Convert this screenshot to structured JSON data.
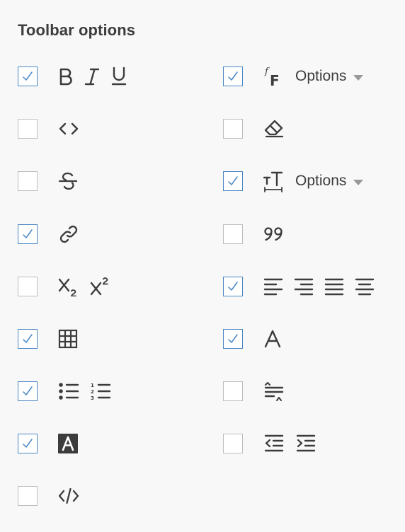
{
  "panel": {
    "title": "Toolbar options",
    "accent_color": "#4a86c5",
    "unchecked_border_color": "#bdbdbd"
  },
  "left_column": [
    {
      "id": "basic-formatting",
      "checked": true,
      "icons": [
        "bold-icon",
        "italic-icon",
        "underline-icon"
      ]
    },
    {
      "id": "code",
      "checked": false,
      "icons": [
        "code-icon"
      ]
    },
    {
      "id": "strikethrough",
      "checked": false,
      "icons": [
        "strikethrough-icon"
      ]
    },
    {
      "id": "link",
      "checked": true,
      "icons": [
        "link-icon"
      ]
    },
    {
      "id": "sub-superscript",
      "checked": false,
      "icons": [
        "subscript-icon",
        "superscript-icon"
      ]
    },
    {
      "id": "table",
      "checked": true,
      "icons": [
        "table-icon"
      ]
    },
    {
      "id": "lists",
      "checked": true,
      "icons": [
        "bulleted-list-icon",
        "numbered-list-icon"
      ]
    },
    {
      "id": "highlight",
      "checked": true,
      "icons": [
        "background-color-icon"
      ]
    },
    {
      "id": "source-code",
      "checked": false,
      "icons": [
        "source-code-icon"
      ]
    }
  ],
  "right_column": [
    {
      "id": "font-family",
      "checked": true,
      "icons": [
        "font-family-icon"
      ],
      "options_label": "Options"
    },
    {
      "id": "clear-format",
      "checked": false,
      "icons": [
        "eraser-icon"
      ]
    },
    {
      "id": "font-size",
      "checked": true,
      "icons": [
        "font-size-icon"
      ],
      "options_label": "Options"
    },
    {
      "id": "blockquote",
      "checked": false,
      "icons": [
        "quote-icon"
      ]
    },
    {
      "id": "alignment",
      "checked": true,
      "icons": [
        "align-left-icon",
        "align-right-icon",
        "align-justify-icon",
        "align-center-icon"
      ]
    },
    {
      "id": "text-color",
      "checked": true,
      "icons": [
        "text-color-icon"
      ]
    },
    {
      "id": "line-height",
      "checked": false,
      "icons": [
        "line-height-icon"
      ]
    },
    {
      "id": "indentation",
      "checked": false,
      "icons": [
        "outdent-icon",
        "indent-icon"
      ]
    }
  ]
}
